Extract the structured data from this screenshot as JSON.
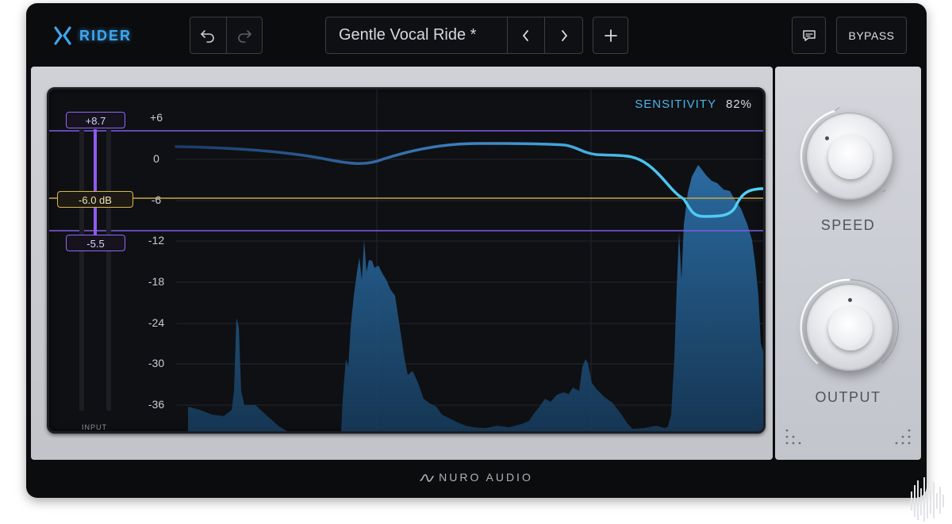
{
  "header": {
    "logo_text": "RIDER",
    "preset_name": "Gentle Vocal Ride *",
    "bypass_label": "BYPASS",
    "icons": [
      "undo-icon",
      "redo-icon",
      "chevron-left-icon",
      "chevron-right-icon",
      "plus-icon",
      "comment-icon"
    ]
  },
  "display": {
    "sensitivity_label": "SENSITIVITY",
    "sensitivity_value": "82%",
    "y_axis_labels": [
      "+6",
      "0",
      "-6",
      "-12",
      "-18",
      "-24",
      "-30",
      "-36"
    ],
    "upper_limit_tag": "+8.7",
    "target_tag": "-6.0 dB",
    "lower_limit_tag": "-5.5",
    "input_label": "INPUT"
  },
  "controls": {
    "speed_label": "SPEED",
    "output_label": "OUTPUT"
  },
  "footer": {
    "brand": "NURO AUDIO"
  },
  "colors": {
    "accent_blue": "#3fa6ef",
    "limit_purple": "#8f68f5",
    "target_gold": "#d8b752",
    "curve_cyan": "#46c6ee"
  }
}
